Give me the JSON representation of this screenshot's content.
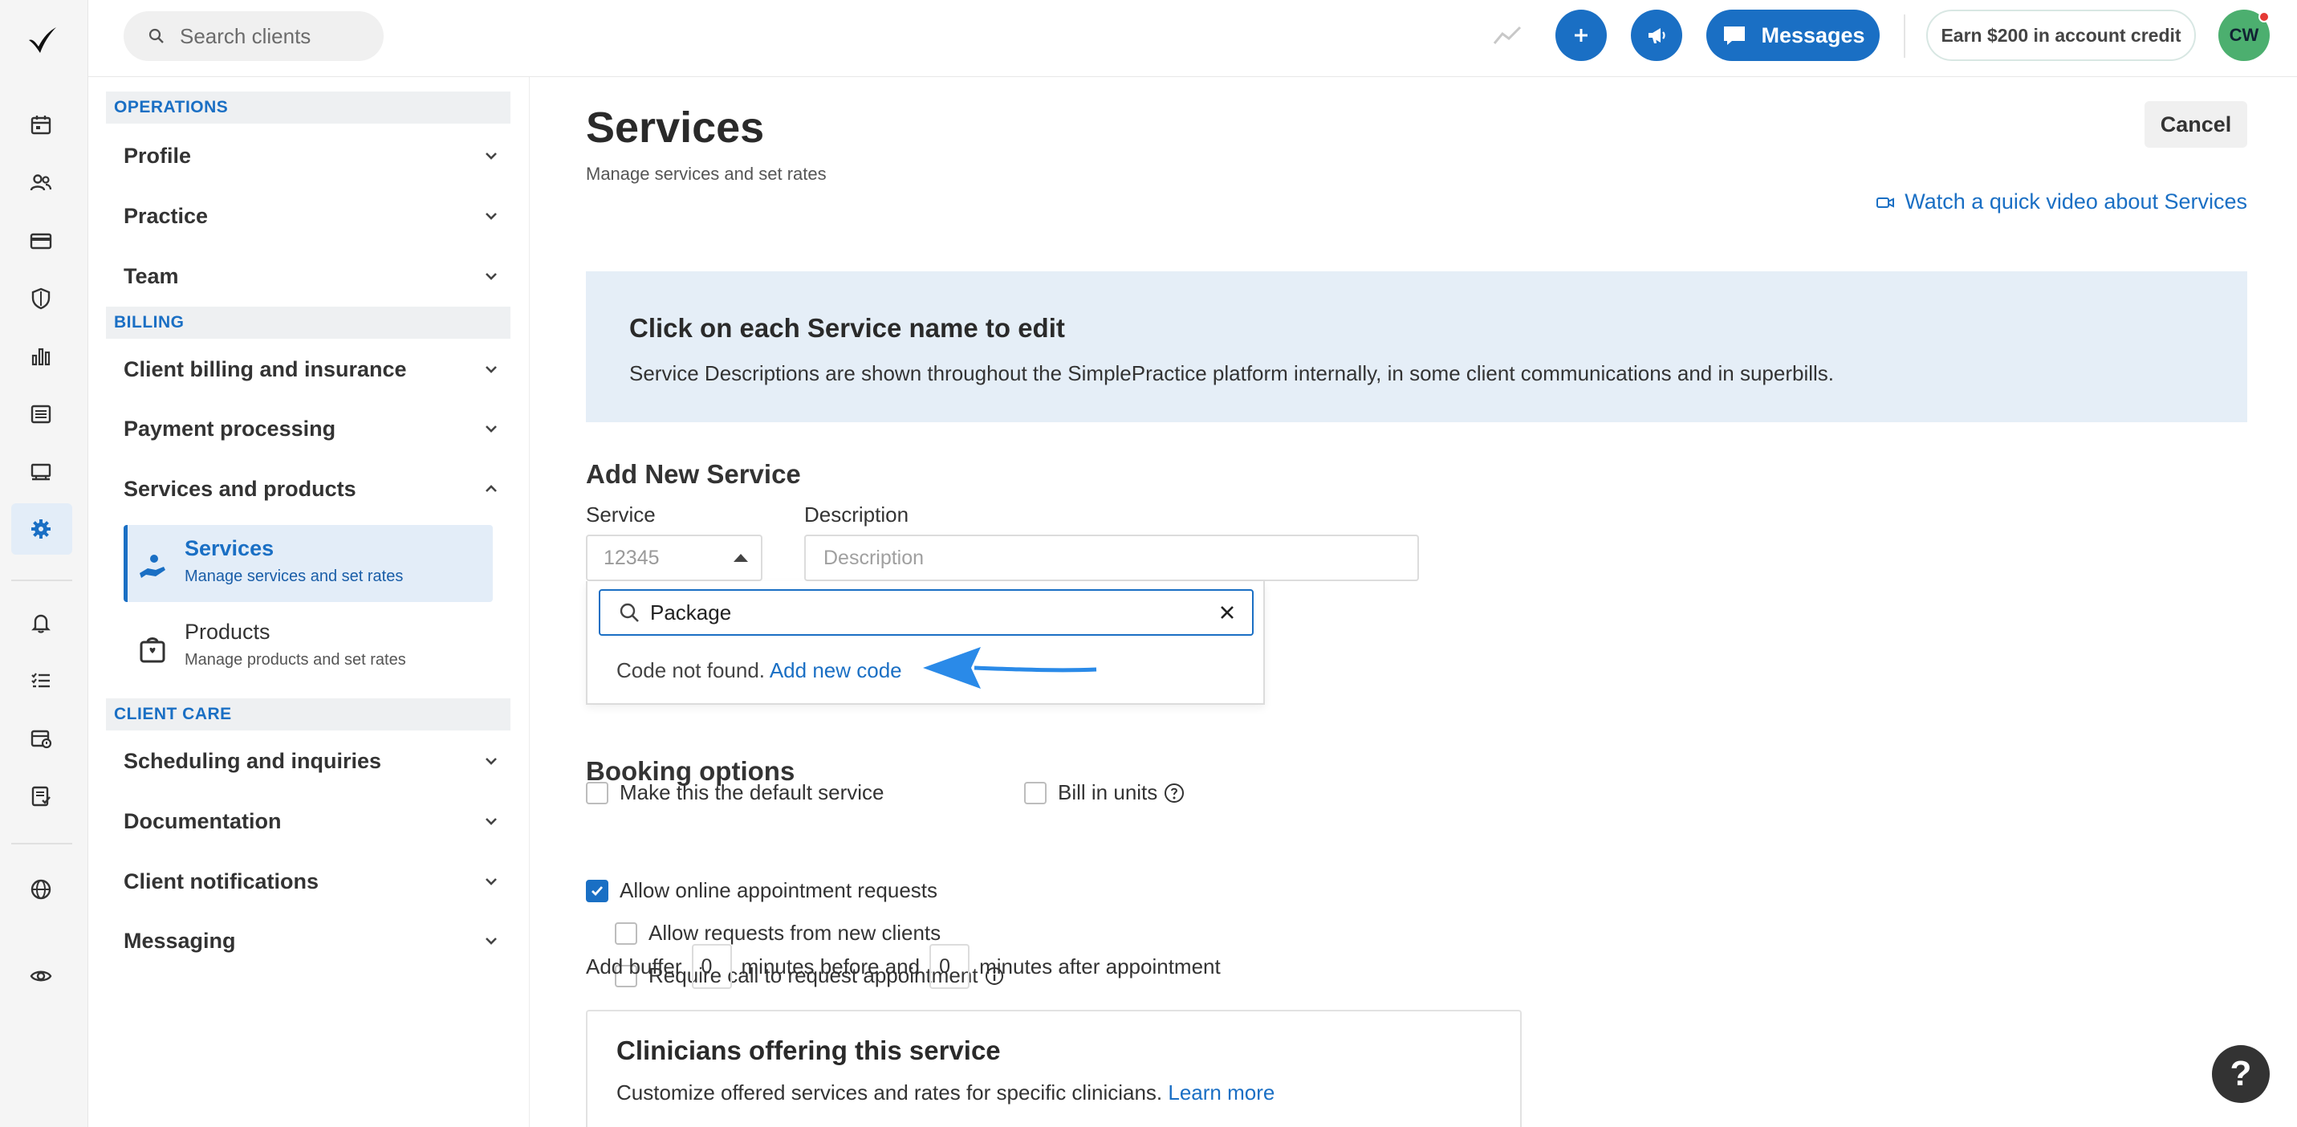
{
  "topbar": {
    "search_placeholder": "Search clients",
    "messages_label": "Messages",
    "earn_label": "Earn $200 in account credit",
    "avatar_initials": "CW"
  },
  "settings_nav": {
    "sections": [
      {
        "heading": "OPERATIONS",
        "items": [
          "Profile",
          "Practice",
          "Team"
        ]
      },
      {
        "heading": "BILLING",
        "items": [
          "Client billing and insurance",
          "Payment processing",
          "Services and products"
        ]
      },
      {
        "heading": "CLIENT CARE",
        "items": [
          "Scheduling and inquiries",
          "Documentation",
          "Client notifications",
          "Messaging"
        ]
      }
    ],
    "sub_items": [
      {
        "label": "Services",
        "desc": "Manage services and set rates"
      },
      {
        "label": "Products",
        "desc": "Manage products and set rates"
      }
    ]
  },
  "page": {
    "title": "Services",
    "subtitle": "Manage services and set rates",
    "cancel_label": "Cancel",
    "video_link": "Watch a quick video about Services"
  },
  "info": {
    "heading": "Click on each Service name to edit",
    "body": "Service Descriptions are shown throughout the SimplePractice platform internally, in some client communications and in superbills."
  },
  "add_service": {
    "heading": "Add New Service",
    "service_label": "Service",
    "service_placeholder": "12345",
    "description_label": "Description",
    "description_placeholder": "Description",
    "dropdown": {
      "search_value": "Package",
      "not_found_text": "Code not found.",
      "add_link": "Add new code"
    },
    "default_service_label": "Make this the default service",
    "bill_in_units_label": "Bill in units"
  },
  "booking": {
    "heading": "Booking options",
    "allow_online": "Allow online appointment requests",
    "allow_online_checked": true,
    "allow_new_clients": "Allow requests from new clients",
    "require_call": "Require call to request appointment",
    "buffer_prefix": "Add buffer",
    "buffer_before_value": "0",
    "buffer_middle": "minutes before and",
    "buffer_after_value": "0",
    "buffer_suffix": "minutes after appointment"
  },
  "clinicians": {
    "heading": "Clinicians offering this service",
    "body": "Customize offered services and rates for specific clinicians.",
    "learn_more": "Learn more"
  },
  "help_label": "?",
  "colors": {
    "accent": "#1a6fc4",
    "info_bg": "#e5eef7",
    "active_bg": "#e3edf8"
  }
}
